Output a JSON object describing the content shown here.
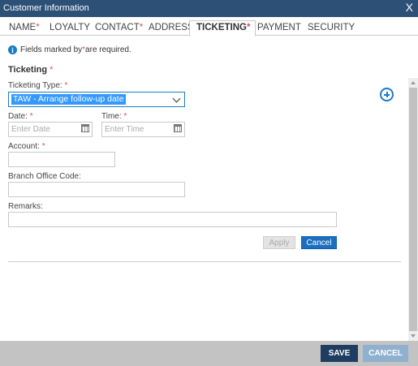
{
  "window": {
    "title": "Customer Information",
    "close_glyph": "X"
  },
  "tabs": [
    {
      "label": "NAME",
      "required": "*"
    },
    {
      "label": "LOYALTY",
      "required": ""
    },
    {
      "label": "CONTACT",
      "required": "*"
    },
    {
      "label": "ADDRESS",
      "required": ""
    },
    {
      "label": "TICKETING",
      "required": "*",
      "active": true
    },
    {
      "label": "PAYMENT",
      "required": ""
    },
    {
      "label": "SECURITY",
      "required": ""
    }
  ],
  "info": {
    "icon": "info-icon",
    "before": "Fields marked by ",
    "mark": "*",
    "after": " are required."
  },
  "section": {
    "title": "Ticketing",
    "required": "*"
  },
  "form": {
    "ticketing_type": {
      "label": "Ticketing Type:",
      "required": "*",
      "value": "TAW - Arrange follow-up date"
    },
    "date": {
      "label": "Date:",
      "required": "*",
      "placeholder": "Enter Date",
      "icon": "calendar-icon"
    },
    "time": {
      "label": "Time:",
      "required": "*",
      "placeholder": "Enter Time",
      "icon": "calendar-icon"
    },
    "account": {
      "label": "Account:",
      "required": "*",
      "value": ""
    },
    "branch_office_code": {
      "label": "Branch Office Code:",
      "value": ""
    },
    "remarks": {
      "label": "Remarks:",
      "value": ""
    }
  },
  "actions": {
    "apply": "Apply",
    "cancel": "Cancel",
    "add_icon": "plus-circle-icon"
  },
  "footer": {
    "save": "SAVE",
    "cancel": "CANCEL"
  },
  "colors": {
    "titlebar": "#2d5077",
    "accent": "#1a7bc8",
    "required": "#d9534f",
    "save": "#1f3d60",
    "cancel_footer": "#8fb0cf"
  }
}
